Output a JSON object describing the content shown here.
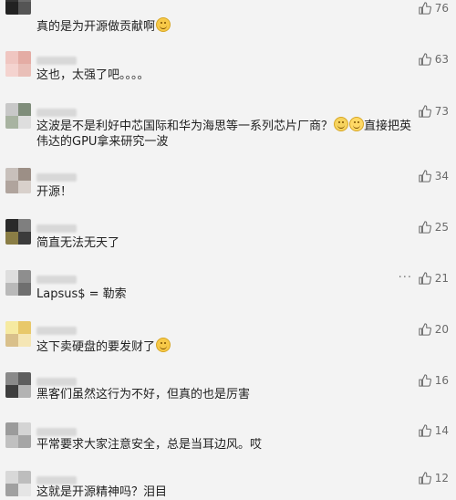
{
  "comments": [
    {
      "text": "真的是为开源做贡献啊",
      "likes": "76",
      "emoji": "smile-icon"
    },
    {
      "text": "这也，太强了吧。。。。",
      "likes": "63"
    },
    {
      "text": "这波是不是利好中芯国际和华为海思等一系列芯片厂商？",
      "text_after": "直接把英伟达的GPU拿来研究一波",
      "likes": "73",
      "emoji": "laugh-icon"
    },
    {
      "text": "开源！",
      "likes": "34"
    },
    {
      "text": "简直无法无天了",
      "likes": "25"
    },
    {
      "text": "Lapsus$ = 勒索",
      "likes": "21",
      "more": "···"
    },
    {
      "text": "这下卖硬盘的要发财了",
      "likes": "20",
      "emoji": "smile-icon"
    },
    {
      "text": "黑客们虽然这行为不好，但真的也是厉害",
      "likes": "16"
    },
    {
      "text": "平常要求大家注意安全，总是当耳边风。哎",
      "likes": "14"
    },
    {
      "text": "这就是开源精神吗？泪目",
      "likes": "12"
    }
  ],
  "icons": {
    "like": "thumbs-up-icon",
    "more": "more-options-icon"
  },
  "colors": {
    "background": "#f3f3f3",
    "text": "#1f1f1f",
    "meta": "#6b6b6b"
  }
}
